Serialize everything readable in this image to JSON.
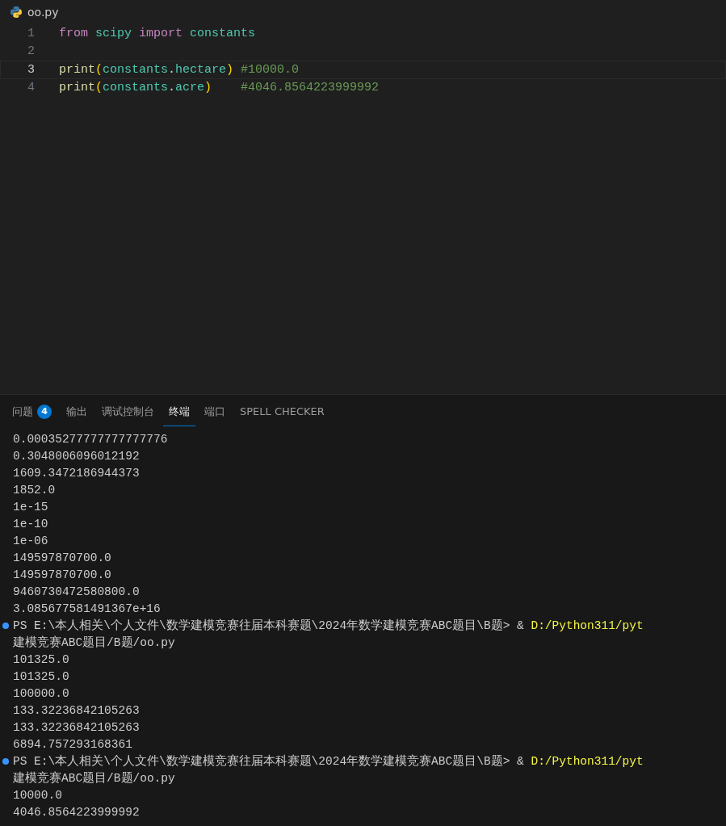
{
  "editor_tab": {
    "title": "oo.py"
  },
  "code": [
    {
      "number": "1",
      "current": false,
      "tokens": [
        {
          "kind": "keyword",
          "text": "from",
          "spaced": true
        },
        {
          "kind": "module",
          "text": "scipy",
          "spaced": true
        },
        {
          "kind": "keyword",
          "text": "import",
          "spaced": true
        },
        {
          "kind": "module",
          "text": "constants"
        }
      ]
    },
    {
      "number": "2",
      "current": false
    },
    {
      "number": "3",
      "current": true,
      "tokens": [
        {
          "kind": "func",
          "text": "print"
        },
        {
          "kind": "paren",
          "text": "("
        },
        {
          "kind": "module",
          "text": "constants"
        },
        {
          "kind": "plain",
          "text": "."
        },
        {
          "kind": "module",
          "text": "hectare"
        },
        {
          "kind": "paren",
          "text": ")"
        },
        {
          "kind": "comment",
          "text": "#10000.0"
        }
      ]
    },
    {
      "number": "4",
      "current": false,
      "tokens": [
        {
          "kind": "func",
          "text": "print"
        },
        {
          "kind": "paren",
          "text": "("
        },
        {
          "kind": "module",
          "text": "constants"
        },
        {
          "kind": "plain",
          "text": "."
        },
        {
          "kind": "module",
          "text": "acre"
        },
        {
          "kind": "paren",
          "text": ")"
        },
        {
          "kind": "comment",
          "text": "#4046.8564223999992"
        }
      ]
    }
  ],
  "panel_tabs": [
    {
      "label": "问题",
      "badge": "4",
      "selected": false
    },
    {
      "label": "输出",
      "selected": false
    },
    {
      "label": "调试控制台",
      "selected": false
    },
    {
      "label": "终端",
      "selected": true
    },
    {
      "label": "端口",
      "selected": false
    },
    {
      "label": "SPELL CHECKER",
      "selected": false
    }
  ],
  "terminal": [
    {
      "kind": "output",
      "text": "0.00035277777777777776"
    },
    {
      "kind": "output",
      "text": "0.3048006096012192"
    },
    {
      "kind": "output",
      "text": "1609.3472186944373"
    },
    {
      "kind": "output",
      "text": "1852.0"
    },
    {
      "kind": "output",
      "text": "1e-15"
    },
    {
      "kind": "output",
      "text": "1e-10"
    },
    {
      "kind": "output",
      "text": "1e-06"
    },
    {
      "kind": "output",
      "text": "149597870700.0"
    },
    {
      "kind": "output",
      "text": "149597870700.0"
    },
    {
      "kind": "output",
      "text": "9460730472580800.0"
    },
    {
      "kind": "output",
      "text": "3.085677581491367e+16"
    },
    {
      "kind": "prompt",
      "text": "PS E:\\本人相关\\个人文件\\数学建模竞赛往届本科赛题\\2024年数学建模竞赛ABC题目\\B题> & ",
      "path": "D:/Python311/pyt"
    },
    {
      "kind": "output",
      "text": "建模竞赛ABC题目/B题/oo.py"
    },
    {
      "kind": "output",
      "text": "101325.0"
    },
    {
      "kind": "output",
      "text": "101325.0"
    },
    {
      "kind": "output",
      "text": "100000.0"
    },
    {
      "kind": "output",
      "text": "133.32236842105263"
    },
    {
      "kind": "output",
      "text": "133.32236842105263"
    },
    {
      "kind": "output",
      "text": "6894.757293168361"
    },
    {
      "kind": "prompt",
      "text": "PS E:\\本人相关\\个人文件\\数学建模竞赛往届本科赛题\\2024年数学建模竞赛ABC题目\\B题> & ",
      "path": "D:/Python311/pyt"
    },
    {
      "kind": "output",
      "text": "建模竞赛ABC题目/B题/oo.py"
    },
    {
      "kind": "output",
      "text": "10000.0"
    },
    {
      "kind": "output",
      "text": "4046.8564223999992"
    }
  ]
}
